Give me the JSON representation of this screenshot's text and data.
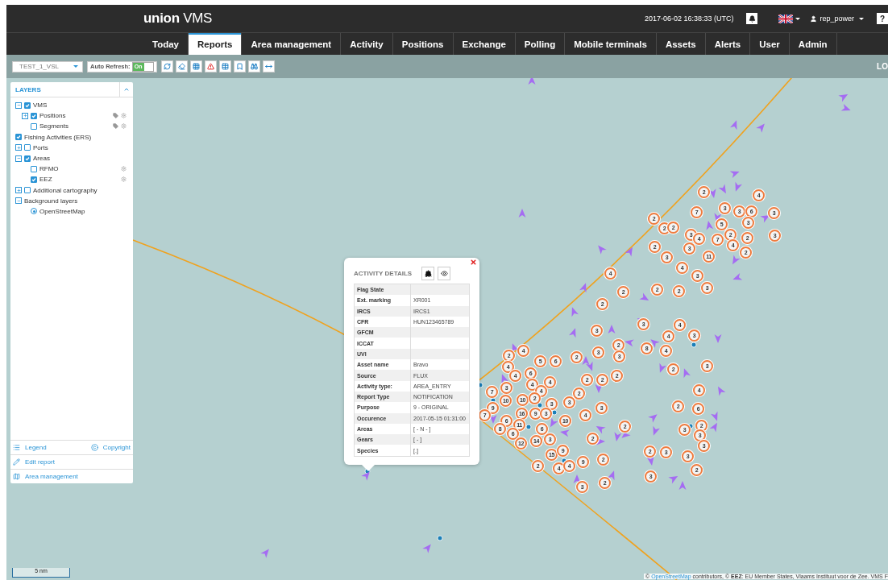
{
  "header": {
    "logo_bold": "union",
    "logo_light": "VMS",
    "datetime": "2017-06-02 16:38:33 (UTC)",
    "user": "rep_power",
    "help": "?"
  },
  "nav": [
    {
      "label": "Today",
      "selected": false
    },
    {
      "label": "Reports",
      "selected": true
    },
    {
      "label": "Area management",
      "selected": false
    },
    {
      "label": "Activity",
      "selected": false
    },
    {
      "label": "Positions",
      "selected": false
    },
    {
      "label": "Exchange",
      "selected": false
    },
    {
      "label": "Polling",
      "selected": false
    },
    {
      "label": "Mobile terminals",
      "selected": false
    },
    {
      "label": "Assets",
      "selected": false
    },
    {
      "label": "Alerts",
      "selected": false
    },
    {
      "label": "User",
      "selected": false
    },
    {
      "label": "Admin",
      "selected": false
    }
  ],
  "toolbar": {
    "report": "TEST_1_VSL",
    "auto_refresh_label": "Auto Refresh:",
    "auto_refresh": {
      "on": true,
      "label": "On"
    },
    "right_text": "LO"
  },
  "layers": {
    "title": "LAYERS",
    "items": [
      {
        "kind": "group",
        "label": "VMS",
        "checked": true,
        "expanded": true,
        "children": [
          {
            "kind": "group",
            "label": "Positions",
            "checked": true,
            "expanded": false,
            "labels": true,
            "settings": true
          },
          {
            "kind": "layer",
            "label": "Segments",
            "checked": false,
            "labels": true,
            "settings": true
          }
        ]
      },
      {
        "kind": "layer",
        "label": "Fishing Activities (ERS)",
        "checked": true
      },
      {
        "kind": "group",
        "label": "Ports",
        "checked": false,
        "expanded": false
      },
      {
        "kind": "group",
        "label": "Areas",
        "checked": true,
        "expanded": true,
        "children": [
          {
            "kind": "layer",
            "label": "RFMO",
            "checked": false,
            "settings": true
          },
          {
            "kind": "layer",
            "label": "EEZ",
            "checked": true,
            "settings": true
          }
        ]
      },
      {
        "kind": "group",
        "label": "Additional cartography",
        "checked": false,
        "expanded": false
      },
      {
        "kind": "folder",
        "label": "Background layers",
        "expanded": true,
        "children": [
          {
            "kind": "base",
            "label": "OpenStreetMap",
            "selected": true
          }
        ]
      }
    ],
    "footer": [
      {
        "kind": "legend",
        "label": "Legend"
      },
      {
        "kind": "copyright",
        "label": "Copyright"
      },
      {
        "kind": "edit",
        "label": "Edit report"
      },
      {
        "kind": "areas",
        "label": "Area management"
      }
    ]
  },
  "popup": {
    "title": "ACTIVITY DETAILS",
    "rows": [
      {
        "label": "Flag State"
      },
      {
        "label": "Ext. marking",
        "value": "XR001"
      },
      {
        "label": "IRCS",
        "value": "IRCS1"
      },
      {
        "label": "CFR",
        "value": "HUN123465789"
      },
      {
        "label": "GFCM"
      },
      {
        "label": "ICCAT"
      },
      {
        "label": "UVI"
      },
      {
        "label": "Asset name",
        "value": "Bravo"
      },
      {
        "label": "Source",
        "value": "FLUX"
      },
      {
        "label": "Activity type:",
        "value": "AREA_ENTRY"
      },
      {
        "label": "Report Type",
        "value": "NOTIFICATION"
      },
      {
        "label": "Purpose",
        "value": "9 - ORIGINAL"
      },
      {
        "label": "Occurence",
        "value": "2017-05-15 01:31:00"
      },
      {
        "label": "Areas",
        "value": "[ - N - ]"
      },
      {
        "label": "Gears",
        "value": "[ - ]"
      },
      {
        "label": "Species",
        "value": "[.]"
      }
    ]
  },
  "clusters": [
    "2",
    "4",
    "7",
    "3",
    "3",
    "6",
    "3",
    "3",
    "5",
    "2",
    "2",
    "2",
    "3",
    "4",
    "7",
    "2",
    "2",
    "3",
    "4",
    "2",
    "2",
    "3",
    "11",
    "3",
    "4",
    "3",
    "3",
    "4",
    "2",
    "2",
    "2",
    "2",
    "3",
    "3",
    "4",
    "4",
    "3",
    "2",
    "3",
    "3",
    "8",
    "4",
    "2",
    "3",
    "2",
    "2",
    "4",
    "5",
    "6",
    "4",
    "4",
    "6",
    "4",
    "4",
    "2",
    "2",
    "2",
    "3",
    "4",
    "2",
    "7",
    "10",
    "10",
    "2",
    "3",
    "3",
    "9",
    "16",
    "9",
    "3",
    "7",
    "6",
    "11",
    "6",
    "10",
    "4",
    "3",
    "8",
    "6",
    "12",
    "14",
    "3",
    "2",
    "2",
    "15",
    "9",
    "4",
    "4",
    "9",
    "2",
    "2",
    "3",
    "2",
    "4",
    "2",
    "6",
    "2",
    "3",
    "3",
    "3",
    "2",
    "3",
    "3",
    "2",
    "3"
  ],
  "scale": "5 nm",
  "attribution": {
    "prefix": "©",
    "link": "OpenStreetMap",
    "text": "contributors, © **EEZ**: EU Member States, Vlaams Instituut voor de Zee. VMS F"
  }
}
